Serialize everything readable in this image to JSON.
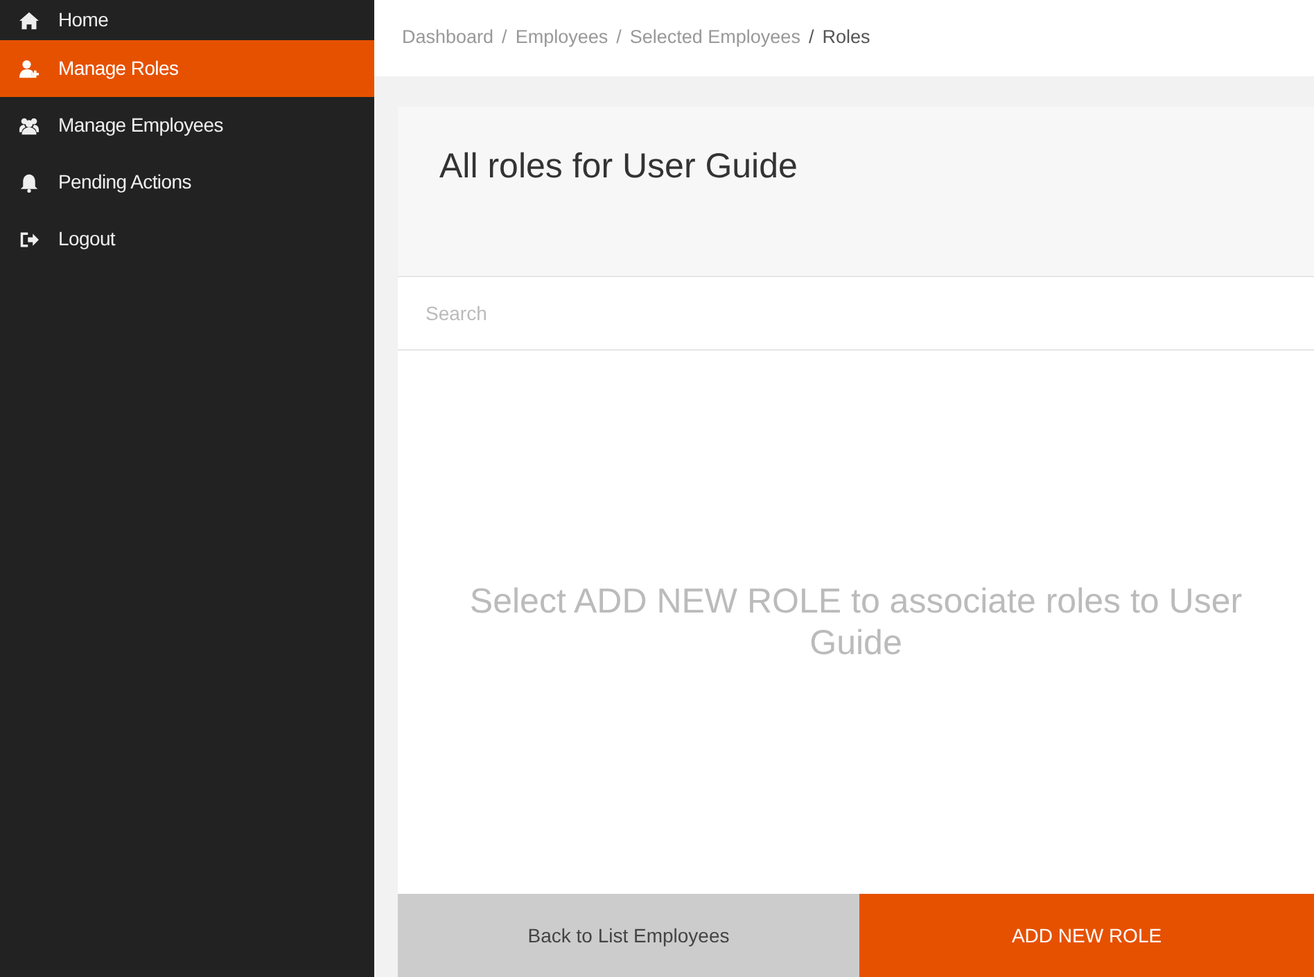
{
  "sidebar": {
    "items": [
      {
        "label": "Home",
        "selected": false
      },
      {
        "label": "Manage Roles",
        "selected": true
      },
      {
        "label": "Manage Employees",
        "selected": false
      },
      {
        "label": "Pending Actions",
        "selected": false
      },
      {
        "label": "Logout",
        "selected": false
      }
    ]
  },
  "breadcrumb": [
    {
      "label": "Dashboard",
      "current": false
    },
    {
      "label": "Employees",
      "current": false
    },
    {
      "label": "Selected Employees",
      "current": false
    },
    {
      "label": "Roles",
      "current": true
    }
  ],
  "breadcrumb_separator": "/",
  "card": {
    "title": "All roles for User Guide",
    "search": {
      "placeholder": "Search"
    },
    "empty_message": "Select ADD NEW ROLE to associate roles to User Guide"
  },
  "buttons": [
    {
      "label": "Back to List Employees",
      "kind": "secondary"
    },
    {
      "label": "ADD NEW ROLE",
      "kind": "primary"
    }
  ]
}
